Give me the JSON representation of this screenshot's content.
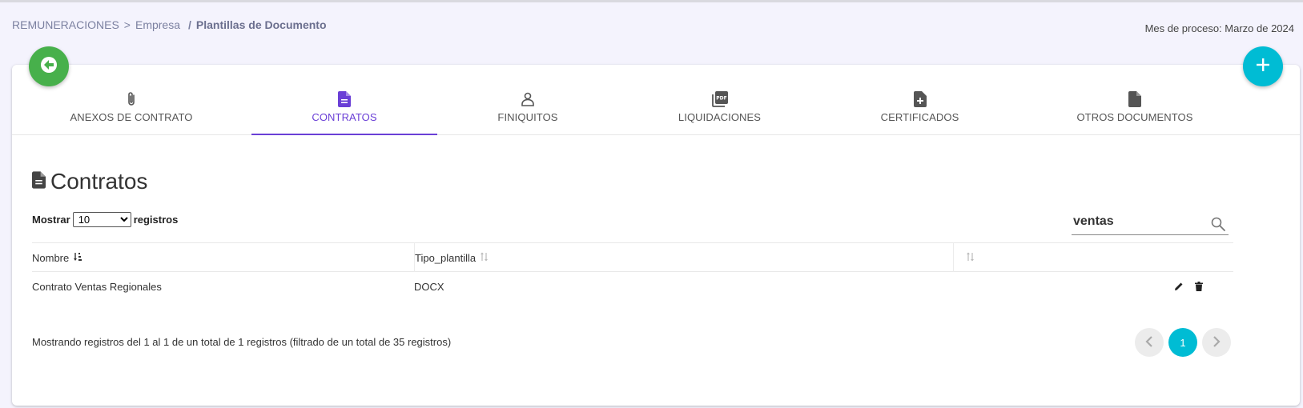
{
  "breadcrumb": {
    "root": "REMUNERACIONES",
    "sep1": ">",
    "company": "Empresa",
    "sep2": "/",
    "current": "Plantillas de Documento"
  },
  "process_month": "Mes de proceso: Marzo de 2024",
  "tabs": [
    {
      "label": "ANEXOS DE CONTRATO",
      "icon": "paperclip-icon"
    },
    {
      "label": "CONTRATOS",
      "icon": "file-document-icon",
      "active": true
    },
    {
      "label": "FINIQUITOS",
      "icon": "person-icon"
    },
    {
      "label": "LIQUIDACIONES",
      "icon": "pdf-icon"
    },
    {
      "label": "CERTIFICADOS",
      "icon": "file-plus-icon"
    },
    {
      "label": "OTROS DOCUMENTOS",
      "icon": "file-icon"
    }
  ],
  "section": {
    "title": "Contratos",
    "icon": "file-document-icon"
  },
  "length": {
    "prefix": "Mostrar",
    "selected": "10",
    "suffix": "registros"
  },
  "search": {
    "value": "ventas"
  },
  "table": {
    "columns": [
      "Nombre",
      "Tipo_plantilla",
      ""
    ],
    "rows": [
      {
        "nombre": "Contrato Ventas Regionales",
        "tipo": "DOCX"
      }
    ]
  },
  "info": "Mostrando registros del 1 al 1 de un total de 1 registros (filtrado de un total de 35 registros)",
  "pagination": {
    "current": "1"
  },
  "colors": {
    "accent": "#6a3fd6",
    "back": "#47b04b",
    "add": "#00bcd4"
  }
}
